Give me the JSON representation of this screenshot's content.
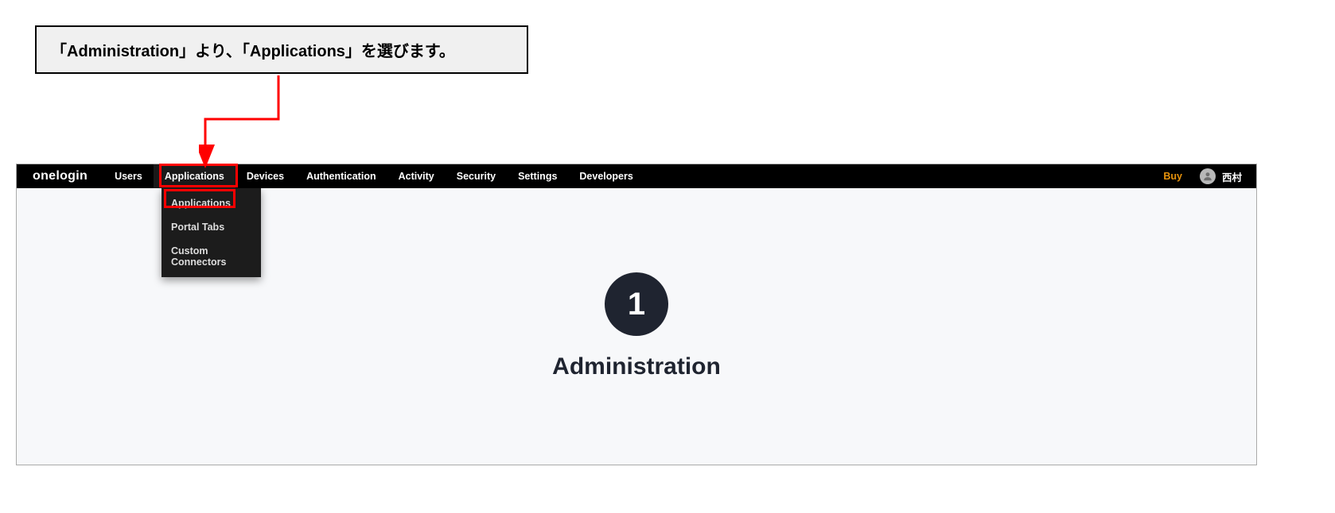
{
  "callout": {
    "text": "「Administration」より、「Applications」を選びます。"
  },
  "brand": "onelogin",
  "nav": {
    "items": [
      {
        "label": "Users"
      },
      {
        "label": "Applications"
      },
      {
        "label": "Devices"
      },
      {
        "label": "Authentication"
      },
      {
        "label": "Activity"
      },
      {
        "label": "Security"
      },
      {
        "label": "Settings"
      },
      {
        "label": "Developers"
      }
    ]
  },
  "dropdown": {
    "items": [
      {
        "label": "Applications"
      },
      {
        "label": "Portal Tabs"
      },
      {
        "label": "Custom Connectors"
      }
    ]
  },
  "right": {
    "buy": "Buy",
    "username": "西村"
  },
  "content": {
    "step_number": "1",
    "step_title": "Administration"
  }
}
